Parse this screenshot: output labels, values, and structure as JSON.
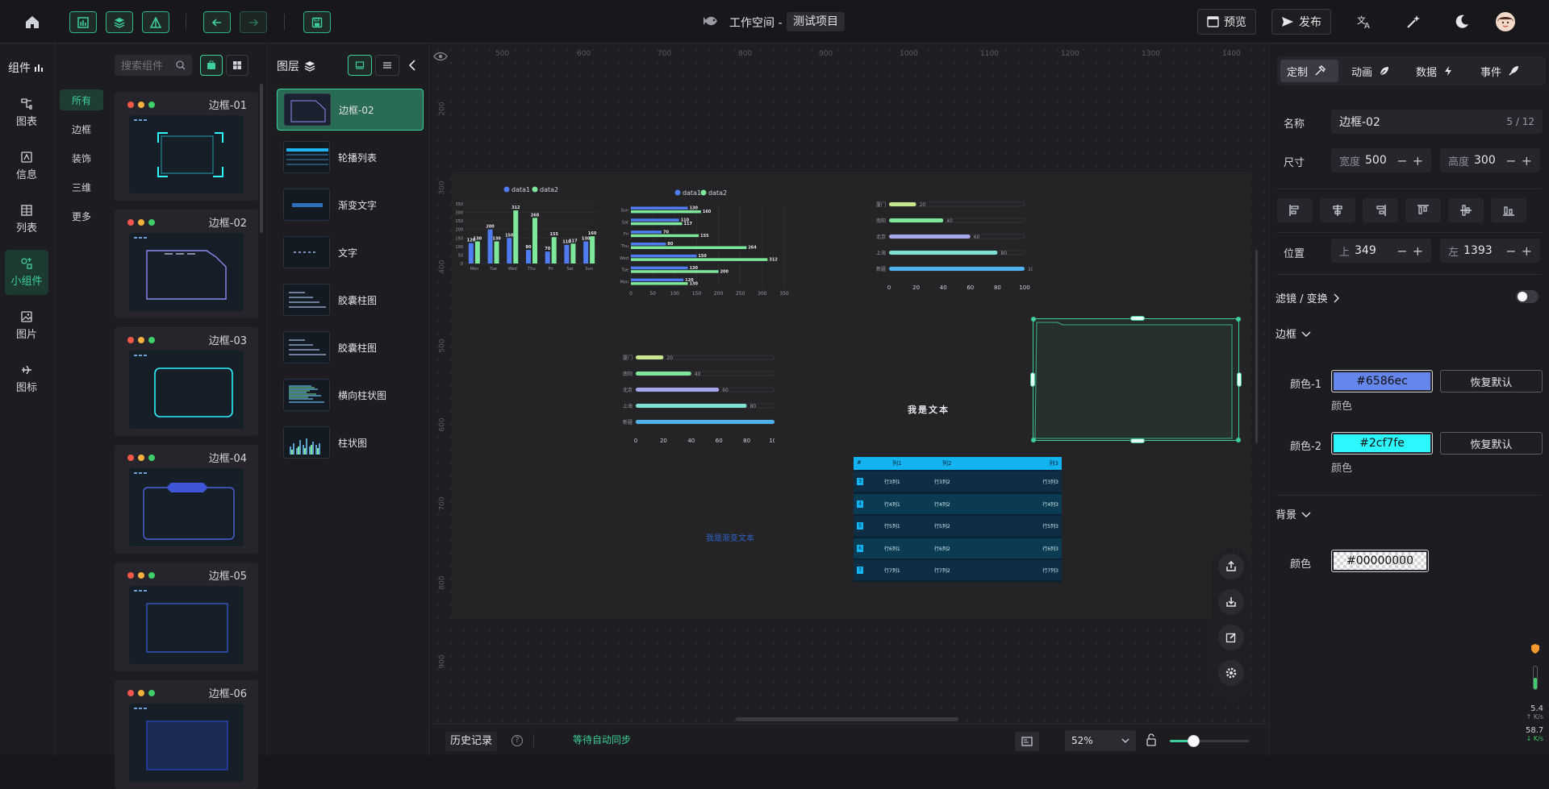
{
  "topbar": {
    "workspace_label": "工作空间 -",
    "project_name": "测试项目",
    "preview_label": "预览",
    "publish_label": "发布"
  },
  "components_panel": {
    "title": "组件",
    "search_placeholder": "搜索组件",
    "nav": [
      {
        "label": "图表",
        "icon": "chart-icon"
      },
      {
        "label": "信息",
        "icon": "info-icon"
      },
      {
        "label": "列表",
        "icon": "table-icon"
      },
      {
        "label": "小组件",
        "icon": "widget-icon",
        "active": true
      },
      {
        "label": "图片",
        "icon": "image-icon"
      },
      {
        "label": "图标",
        "icon": "plane-icon"
      }
    ],
    "sub_nav": [
      "所有",
      "边框",
      "装饰",
      "三维",
      "更多"
    ],
    "cards": [
      "边框-01",
      "边框-02",
      "边框-03",
      "边框-04",
      "边框-05",
      "边框-06"
    ]
  },
  "layers_panel": {
    "title": "图层",
    "items": [
      "边框-02",
      "轮播列表",
      "渐变文字",
      "文字",
      "胶囊柱图",
      "胶囊柱图",
      "横向柱状图",
      "柱状图"
    ]
  },
  "ruler": {
    "top": [
      "500",
      "600",
      "700",
      "800",
      "900",
      "1000",
      "1100",
      "1200",
      "1300",
      "1400"
    ],
    "left": [
      "200",
      "300",
      "400",
      "500",
      "600",
      "700",
      "800",
      "900"
    ]
  },
  "canvas": {
    "text_widget": "我是文本",
    "gradient_text": "我是渐变文本",
    "table": {
      "headers": [
        "#",
        "列1",
        "列2",
        "列3"
      ],
      "rows": [
        [
          "3",
          "行3列1",
          "行3列2",
          "行3列3"
        ],
        [
          "4",
          "行4列1",
          "行4列2",
          "行4列3"
        ],
        [
          "5",
          "行5列1",
          "行5列2",
          "行5列3"
        ],
        [
          "6",
          "行6列1",
          "行6列2",
          "行6列3"
        ],
        [
          "7",
          "行7列1",
          "行7列2",
          "行7列3"
        ]
      ]
    }
  },
  "chart_data": [
    {
      "type": "bar",
      "categories": [
        "Mon",
        "Tue",
        "Wed",
        "Thu",
        "Fri",
        "Sat",
        "Sun"
      ],
      "series": [
        {
          "name": "data1",
          "values": [
            120,
            200,
            150,
            80,
            70,
            110,
            130
          ],
          "color": "#4f7cf0"
        },
        {
          "name": "data2",
          "values": [
            130,
            130,
            312,
            268,
            155,
            117,
            160
          ],
          "color": "#7de89a"
        }
      ],
      "ylim": [
        0,
        350
      ],
      "yticks": [
        "0",
        "50",
        "100",
        "150",
        "200",
        "250",
        "300",
        "350"
      ],
      "legend": "top-center"
    },
    {
      "type": "bar",
      "orientation": "horizontal",
      "categories": [
        "Sun",
        "Sat",
        "Fri",
        "Thu",
        "Wed",
        "Tue",
        "Mon"
      ],
      "series": [
        {
          "name": "data1",
          "values": [
            130,
            110,
            70,
            80,
            150,
            130,
            120
          ],
          "color": "#4f7cf0"
        },
        {
          "name": "data2",
          "values": [
            160,
            117,
            155,
            264,
            312,
            200,
            130
          ],
          "color": "#7de89a"
        }
      ],
      "xlim": [
        0,
        350
      ],
      "xticks": [
        "0",
        "50",
        "100",
        "150",
        "200",
        "250",
        "300",
        "350"
      ],
      "legend": "top-center"
    },
    {
      "type": "bar",
      "orientation": "horizontal-capsule",
      "categories": [
        "厦门",
        "南阳",
        "北京",
        "上海",
        "新疆"
      ],
      "values": [
        20,
        40,
        60,
        80,
        100
      ],
      "colors": [
        "#c8e68e",
        "#7de89a",
        "#a7a6ea",
        "#7ee0d2",
        "#4fb1ee"
      ],
      "xlim": [
        0,
        100
      ],
      "xticks": [
        "0",
        "20",
        "40",
        "60",
        "80",
        "100"
      ]
    },
    {
      "type": "bar",
      "orientation": "horizontal-capsule",
      "categories": [
        "厦门",
        "南阳",
        "北京",
        "上海",
        "新疆"
      ],
      "values": [
        20,
        40,
        60,
        80,
        100
      ],
      "colors": [
        "#c8e68e",
        "#7de89a",
        "#a7a6ea",
        "#7ee0d2",
        "#4fb1ee"
      ],
      "xlim": [
        0,
        100
      ],
      "xticks": [
        "0",
        "20",
        "40",
        "60",
        "80",
        "100"
      ]
    }
  ],
  "properties": {
    "tabs": [
      "定制",
      "动画",
      "数据",
      "事件"
    ],
    "name_label": "名称",
    "name_value": "边框-02",
    "name_count": "5 / 12",
    "size_label": "尺寸",
    "width_label": "宽度",
    "width_value": "500",
    "height_label": "高度",
    "height_value": "300",
    "position_label": "位置",
    "top_label": "上",
    "top_value": "349",
    "left_label": "左",
    "left_value": "1393",
    "filter_label": "滤镜 / 变换",
    "border_section": "边框",
    "color1_label": "颜色-1",
    "color1_value": "#6586ec",
    "color2_label": "颜色-2",
    "color2_value": "#2cf7fe",
    "color_sub": "颜色",
    "reset_label": "恢复默认",
    "background_section": "背景",
    "bg_color_label": "颜色",
    "bg_color_value": "#00000000"
  },
  "bottombar": {
    "history_label": "历史记录",
    "sync_status": "等待自动同步",
    "zoom": "52%",
    "zoom_level": 0.3
  },
  "network": {
    "up": "5.4",
    "down": "58.7",
    "unit": "K/s"
  },
  "colors": {
    "accent": "#3fcf9a",
    "border1": "#6586ec",
    "border2": "#2cf7fe"
  }
}
